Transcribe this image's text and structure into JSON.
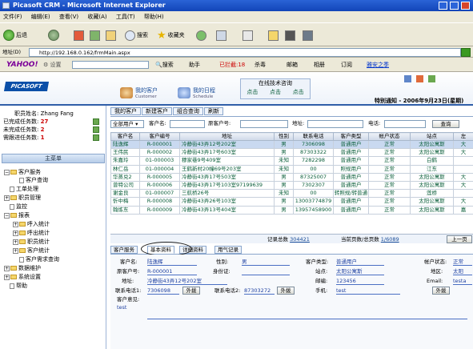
{
  "window": {
    "title": "Picasoft CRM - Microsoft Internet Explorer"
  },
  "menu": [
    "文件(F)",
    "编辑(E)",
    "查看(V)",
    "收藏(A)",
    "工具(T)",
    "帮助(H)"
  ],
  "toolbar": {
    "back": "后退",
    "search": "搜索",
    "favorites": "收藏夹"
  },
  "address": {
    "label": "地址(D)",
    "url": "http://192.168.0.162/frmMain.aspx"
  },
  "yahoo_bar": {
    "logo": "YAHOO!",
    "settings": "设置",
    "search": "搜索",
    "assistant": "助手",
    "blocked": "已拦截:18",
    "antivirus": "杀毒",
    "mail": "邮箱",
    "album": "相册",
    "subscribe": "订阅",
    "classic": "雅安之季"
  },
  "app": {
    "logo": "PICASOFT",
    "nav": [
      {
        "label": "我的客户",
        "sub": "Customer"
      },
      {
        "label": "我的日程",
        "sub": "Schedule"
      }
    ],
    "online_support": {
      "title": "在线技术咨询",
      "links": [
        "点击",
        "点击",
        "点击"
      ]
    },
    "notice": "特别通知 - 2006年9月23日(星期)"
  },
  "left": {
    "user_label": "职员姓名:",
    "user_name": "Zhang Fang",
    "stats": [
      {
        "label": "已完成任务数:",
        "value": "27"
      },
      {
        "label": "未完成任务数:",
        "value": "2"
      },
      {
        "label": "需跟进任务数:",
        "value": "1"
      }
    ],
    "main_menu": "主菜单",
    "tree": [
      {
        "label": "客户服务",
        "type": "folder"
      },
      {
        "label": "客户查询",
        "type": "doc"
      },
      {
        "label": "工单处理",
        "type": "doc"
      },
      {
        "label": "职员管理",
        "type": "folder"
      },
      {
        "label": "监控",
        "type": "doc"
      },
      {
        "label": "报表",
        "type": "folder"
      },
      {
        "label": "呼入统计",
        "type": "folder"
      },
      {
        "label": "呼出统计",
        "type": "folder"
      },
      {
        "label": "职员统计",
        "type": "folder"
      },
      {
        "label": "客户统计",
        "type": "folder"
      },
      {
        "label": "客户需求查询",
        "type": "doc"
      },
      {
        "label": "数据维护",
        "type": "folder"
      },
      {
        "label": "系统设置",
        "type": "folder"
      },
      {
        "label": "帮助",
        "type": "doc"
      }
    ]
  },
  "tabs": [
    "我的客户",
    "新建客户",
    "组合查询",
    "刷新"
  ],
  "filter": {
    "all_users": "全部用户",
    "name_label": "客户名:",
    "no_label": "原客户号:",
    "address_label": "地址:",
    "phone_label": "电话:",
    "query": "查询"
  },
  "grid": {
    "columns": [
      "客户名",
      "客户编号",
      "地址",
      "性别",
      "联系电话",
      "客户类型",
      "帐户状态",
      "站点",
      "左"
    ],
    "rows": [
      [
        "陆逸辉",
        "R-000001",
        "冷静街43弄12号202室",
        "男",
        "7306098",
        "普通用户",
        "正常",
        "太阳公寓斯",
        "大"
      ],
      [
        "王伟民",
        "R-000002",
        "冷静街43弄17号603室",
        "男",
        "87303322",
        "普通用户",
        "正常",
        "太阳公寓斯",
        "大"
      ],
      [
        "朱嘉玲",
        "01-000003",
        "穆家巷9号409室",
        "未知",
        "7282298",
        "普通用户",
        "正常",
        "白鹤",
        ""
      ],
      [
        "林仁岳",
        "01-000004",
        "王鹤新村20幢69号203室",
        "未知",
        "00",
        "照规用户",
        "正常",
        "江东",
        ""
      ],
      [
        "华蒸兑2",
        "R-000005",
        "冷静街43弄17号503室",
        "男",
        "87325007",
        "普通用户",
        "正常",
        "太阳公寓斯",
        "大"
      ],
      [
        "曾特公司",
        "R-000006",
        "冷静街43弄17号103室97199639",
        "男",
        "7302307",
        "普通用户",
        "正常",
        "太阳公寓斯",
        "大"
      ],
      [
        "谢金良",
        "01-000007",
        "三航桥26号",
        "未知",
        "00",
        "转照规/转普通",
        "正常",
        "莲桥",
        ""
      ],
      [
        "忻中梅",
        "R-000008",
        "冷静街43弄26号103室",
        "男",
        "13003774879",
        "普通用户",
        "正常",
        "太阳公寓斯",
        "大"
      ],
      [
        "翰炼东",
        "R-000009",
        "冷静街43弄13号404室",
        "男",
        "13957458900",
        "普通用户",
        "正常",
        "太阳公寓斯",
        "嘉"
      ]
    ],
    "total_label": "记录总数",
    "total": "304421",
    "page_label": "当前页数/总页数",
    "page": "1/6089",
    "prev": "上一页"
  },
  "detail": {
    "tabs": [
      "客户服务",
      "基本资料",
      "详细资料",
      "用气记录"
    ],
    "fields": {
      "name_label": "客户名:",
      "name": "陆逸辉",
      "gender_label": "性别:",
      "gender": "男",
      "type_label": "客户类型:",
      "type": "普通用户",
      "status_label": "帐户状态:",
      "status": "正常",
      "old_no_label": "原客户号:",
      "old_no": "R-000001",
      "id_label": "身份证:",
      "id": "",
      "site_label": "站点:",
      "site": "太阳公寓斯",
      "area_label": "地区:",
      "area": "太阳",
      "addr_label": "地址:",
      "addr": "冷静街43弄12号202室",
      "zip_label": "邮编:",
      "zip": "123456",
      "email_label": "Email:",
      "email": "testa",
      "phone1_label": "联系电话1:",
      "phone1": "7306098",
      "phone2_label": "联系电话2:",
      "phone2": "87303272",
      "ext": "外拨",
      "mobile_label": "手机:",
      "mobile": "test",
      "opinion_label": "客户意见:",
      "opinion": "test"
    }
  }
}
